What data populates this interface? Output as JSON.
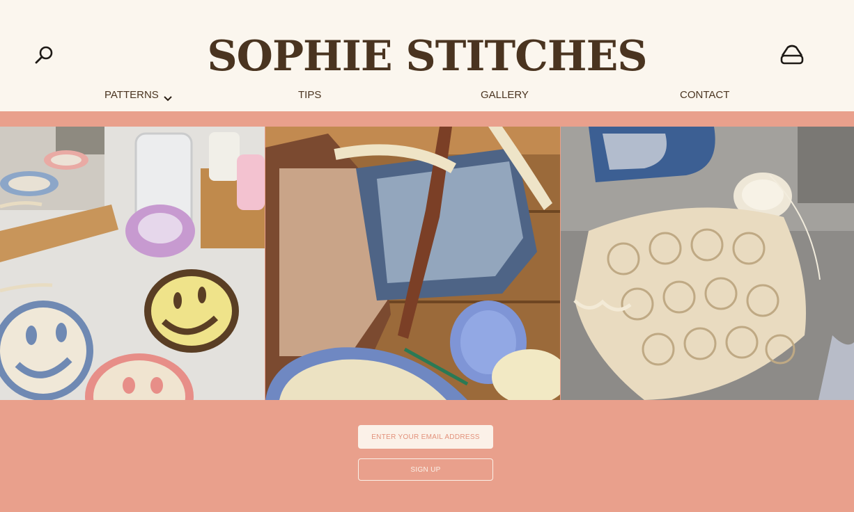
{
  "header": {
    "brand": "SOPHIE STITCHES",
    "search_icon": "search-icon",
    "cart_icon": "basket-icon"
  },
  "nav": {
    "items": [
      {
        "label": "PATTERNS",
        "icon": "chevron-down-icon"
      },
      {
        "label": "TIPS"
      },
      {
        "label": "GALLERY"
      },
      {
        "label": "CONTACT"
      }
    ]
  },
  "colors": {
    "header_bg": "#fbf6ee",
    "accent": "#e9a08c",
    "brand_text": "#4a3420",
    "input_bg": "#fbf1e8"
  },
  "gallery": {
    "photos": [
      {
        "subject": "crochet smiley coasters on a table"
      },
      {
        "subject": "houndstooth crochet shoulder bags with yarn"
      },
      {
        "subject": "cream crochet lace skirt on a sofa"
      }
    ]
  },
  "signup": {
    "email_placeholder": "ENTER YOUR EMAIL ADDRESS",
    "button_label": "SIGN UP"
  }
}
